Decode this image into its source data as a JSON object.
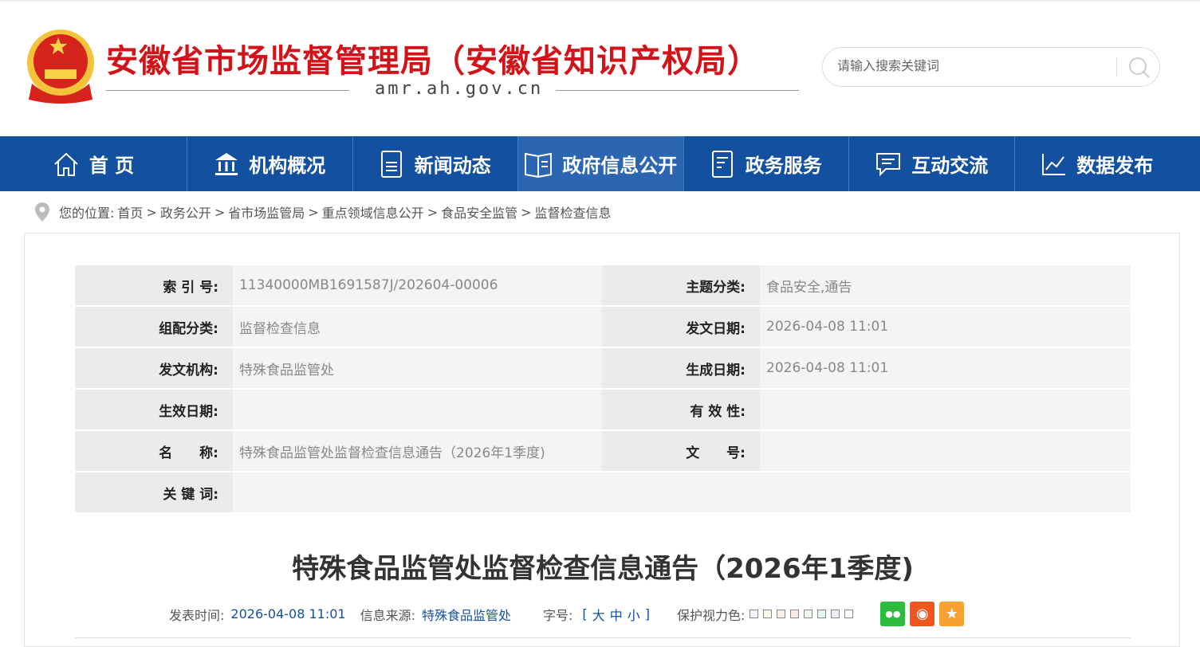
{
  "header": {
    "title": "安徽省市场监督管理局（安徽省知识产权局）",
    "domain": "amr.ah.gov.cn",
    "search_placeholder": "请输入搜索关键词"
  },
  "nav": [
    {
      "label": "首 页",
      "icon": "home-icon"
    },
    {
      "label": "机构概况",
      "icon": "building-icon"
    },
    {
      "label": "新闻动态",
      "icon": "newspaper-icon"
    },
    {
      "label": "政府信息公开",
      "icon": "book-icon"
    },
    {
      "label": "政务服务",
      "icon": "form-icon"
    },
    {
      "label": "互动交流",
      "icon": "chat-icon"
    },
    {
      "label": "数据发布",
      "icon": "chart-icon"
    }
  ],
  "breadcrumb": {
    "prefix": "您的位置:",
    "items": [
      "首页",
      "政务公开",
      "省市场监管局",
      "重点领域信息公开",
      "食品安全监管",
      "监督检查信息"
    ]
  },
  "info": [
    [
      "索 引 号:",
      "11340000MB1691587J/202604-00006",
      "主题分类:",
      "食品安全,通告"
    ],
    [
      "组配分类:",
      "监督检查信息",
      "发文日期:",
      "2026-04-08 11:01"
    ],
    [
      "发文机构:",
      "特殊食品监管处",
      "生成日期:",
      "2026-04-08 11:01"
    ],
    [
      "生效日期:",
      "",
      "有 效 性:",
      ""
    ],
    [
      "名　　称:",
      "特殊食品监管处监督检查信息通告（2026年1季度)",
      "文　　号:",
      ""
    ],
    [
      "关 键 词:",
      "",
      "",
      ""
    ]
  ],
  "article": {
    "title": "特殊食品监管处监督检查信息通告（2026年1季度)",
    "publish_label": "发表时间:",
    "publish_time": "2026-04-08 11:01",
    "source_label": "信息来源:",
    "source": "特殊食品监管处",
    "font_label": "字号:",
    "font_open": "[",
    "font_large": "大",
    "font_medium": "中",
    "font_small": "小",
    "font_close": "]",
    "color_label": "保护视力色:",
    "colors": [
      "#f5f5f5",
      "#fafae8",
      "#f8efe6",
      "#fbe9e6",
      "#eef8e8",
      "#e6f6f3",
      "#eceef6",
      "#ffffff"
    ]
  },
  "share": [
    {
      "name": "wechat",
      "color": "#2fbb3f"
    },
    {
      "name": "weibo",
      "color": "#f0561d"
    },
    {
      "name": "favorite",
      "color": "#f7a131"
    }
  ]
}
